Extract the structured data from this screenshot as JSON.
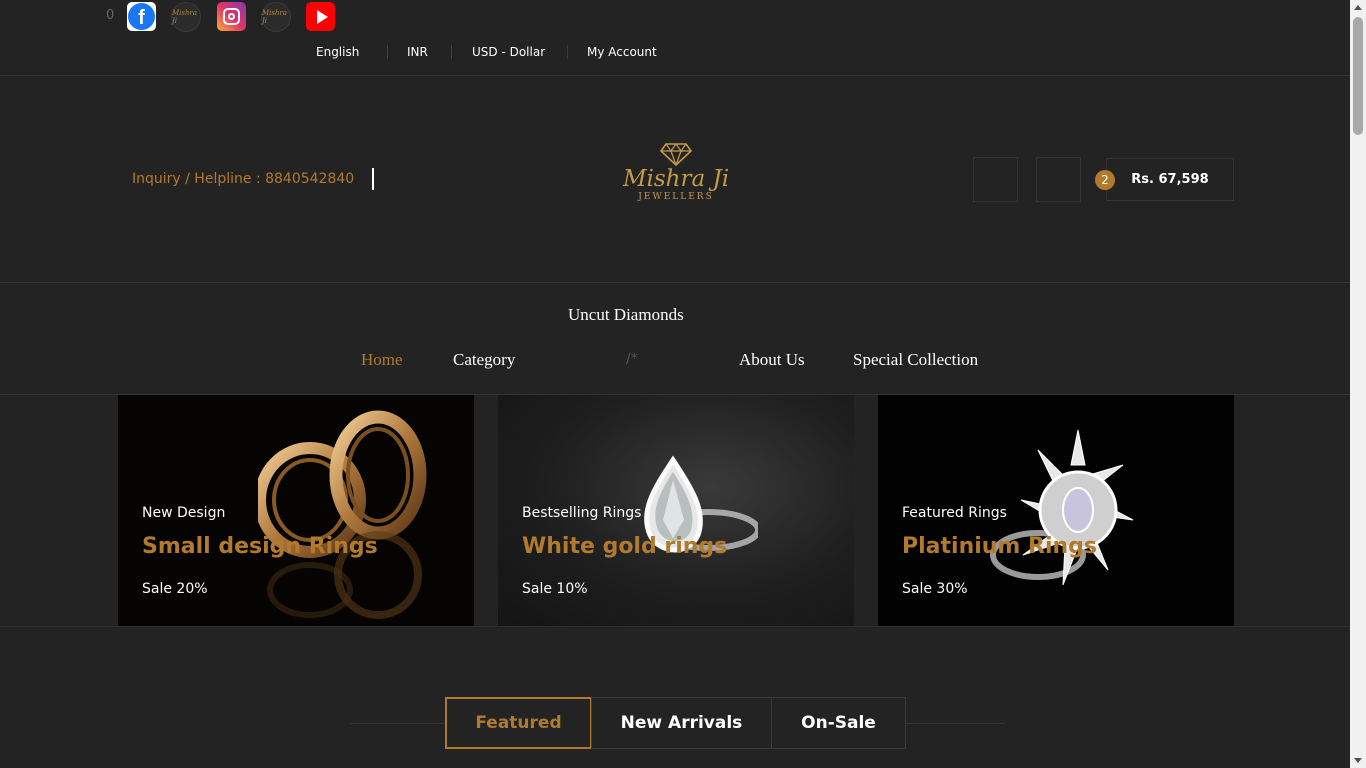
{
  "topbar": {
    "counter": "0",
    "social": {
      "facebook_icon": "facebook-icon",
      "instagram_icon": "instagram-icon",
      "youtube_icon": "youtube-icon",
      "mini_logo_text": "Mishra Ji"
    },
    "links": {
      "language": "English",
      "currency_code": "INR",
      "currency": "USD - Dollar",
      "account": "My Account"
    }
  },
  "header": {
    "helpline": "Inquiry / Helpline : 8840542840",
    "logo": {
      "brand": "Mishra Ji",
      "sub": "JEWELLERS"
    },
    "cart": {
      "count": "2",
      "total": "Rs. 67,598"
    }
  },
  "nav": {
    "top_item": "Uncut Diamonds",
    "items": [
      {
        "label": "Home",
        "active": true
      },
      {
        "label": "Category",
        "active": false
      },
      {
        "label": "About Us",
        "active": false
      },
      {
        "label": "Special Collection",
        "active": false
      }
    ],
    "stray_text": "/*"
  },
  "banners": [
    {
      "tag": "New Design",
      "title": "Small design Rings",
      "sale": "Sale 20%"
    },
    {
      "tag": "Bestselling Rings",
      "title": "White gold rings",
      "sale": "Sale 10%"
    },
    {
      "tag": "Featured Rings",
      "title": "Platinium Rings",
      "sale": "Sale 30%"
    }
  ],
  "product_tabs": [
    {
      "label": "Featured",
      "active": true
    },
    {
      "label": "New Arrivals",
      "active": false
    },
    {
      "label": "On-Sale",
      "active": false
    }
  ],
  "colors": {
    "background": "#232323",
    "accent": "#b27a2c",
    "text": "#ffffff"
  }
}
